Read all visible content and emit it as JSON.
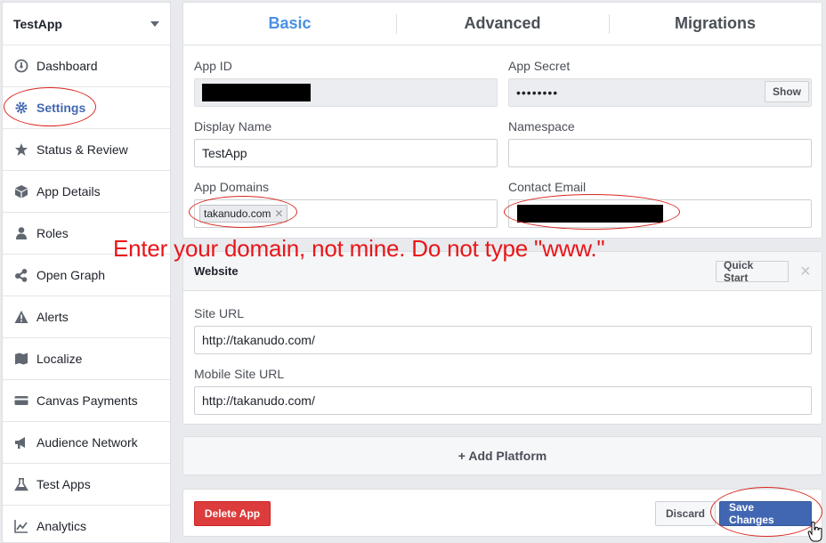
{
  "sidebar": {
    "app_name": "TestApp",
    "items": [
      {
        "label": "Dashboard",
        "icon": "dashboard-icon"
      },
      {
        "label": "Settings",
        "icon": "gear-icon"
      },
      {
        "label": "Status & Review",
        "icon": "star-icon"
      },
      {
        "label": "App Details",
        "icon": "cube-icon"
      },
      {
        "label": "Roles",
        "icon": "person-icon"
      },
      {
        "label": "Open Graph",
        "icon": "share-icon"
      },
      {
        "label": "Alerts",
        "icon": "warning-icon"
      },
      {
        "label": "Localize",
        "icon": "map-icon"
      },
      {
        "label": "Canvas Payments",
        "icon": "card-icon"
      },
      {
        "label": "Audience Network",
        "icon": "megaphone-icon"
      },
      {
        "label": "Test Apps",
        "icon": "flask-icon"
      },
      {
        "label": "Analytics",
        "icon": "chart-icon"
      }
    ],
    "active_index": 1
  },
  "tabs": [
    "Basic",
    "Advanced",
    "Migrations"
  ],
  "basic": {
    "app_id_label": "App ID",
    "app_secret_label": "App Secret",
    "app_secret_value": "••••••••",
    "show_button": "Show",
    "display_name_label": "Display Name",
    "display_name_value": "TestApp",
    "namespace_label": "Namespace",
    "namespace_value": "",
    "app_domains_label": "App Domains",
    "app_domain_token": "takanudo.com",
    "contact_email_label": "Contact Email"
  },
  "annotation": "Enter your domain, not mine.  Do not type \"www.\"",
  "website": {
    "title": "Website",
    "quick_start": "Quick Start",
    "close": "×",
    "site_url_label": "Site URL",
    "site_url_value": "http://takanudo.com/",
    "mobile_url_label": "Mobile Site URL",
    "mobile_url_value": "http://takanudo.com/"
  },
  "add_platform": "+ Add Platform",
  "footer": {
    "delete": "Delete App",
    "discard": "Discard",
    "save": "Save Changes"
  },
  "colors": {
    "accent": "#4267b2",
    "tab_active": "#4a90e2",
    "annotation": "#e8161a",
    "delete": "#dd3c3c"
  }
}
